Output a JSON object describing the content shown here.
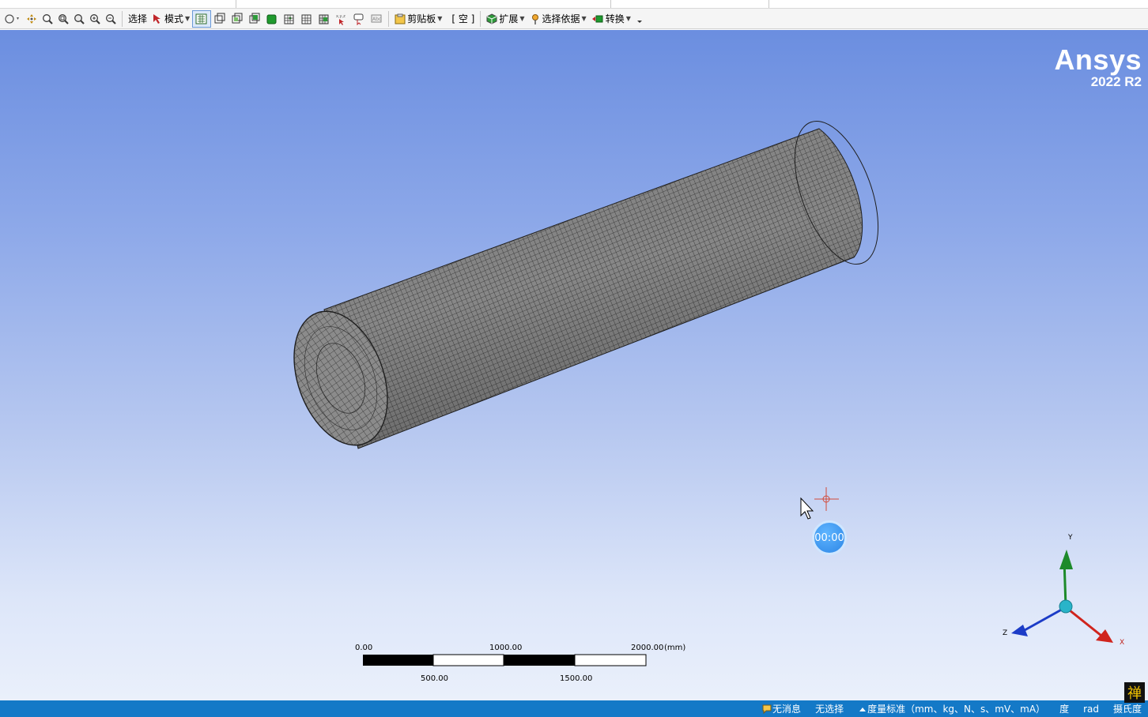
{
  "toolbar": {
    "select_label": "选择",
    "mode_label": "模式",
    "clipboard_label": "剪贴板",
    "clipboard_state": "[ 空 ]",
    "expand_label": "扩展",
    "select_by_label": "选择依据",
    "convert_label": "转换"
  },
  "viewport": {
    "brand_name": "Ansys",
    "brand_version": "2022 R2",
    "timer": "00:00",
    "scale_bar": {
      "top_labels": [
        "0.00",
        "1000.00",
        "2000.00"
      ],
      "bottom_labels": [
        "500.00",
        "1500.00"
      ],
      "unit": "(mm)"
    },
    "triad": {
      "x": "X",
      "y": "Y",
      "z": "Z"
    }
  },
  "statusbar": {
    "messages": "无消息",
    "selection": "无选择",
    "units": "度量标准（mm、kg、N、s、mV、mA）",
    "angle_unit": "度",
    "rad": "rad",
    "temperature": "摄氏度"
  },
  "colors": {
    "status_bar": "#1479c7",
    "viewport_top": "#6b8ee0",
    "viewport_bottom": "#eaf0fb"
  },
  "stamp": "禅"
}
